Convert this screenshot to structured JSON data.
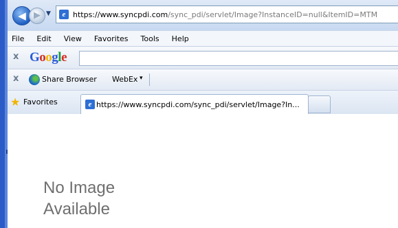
{
  "browser": {
    "url_scheme": "https://",
    "url_domain": "www.syncpdi.com",
    "url_path": "/sync_pdi/servlet/Image?InstanceID=null&ItemID=MTM",
    "menu": [
      "File",
      "Edit",
      "View",
      "Favorites",
      "Tools",
      "Help"
    ],
    "google_toolbar": {
      "logo_letters": [
        "G",
        "o",
        "o",
        "g",
        "l",
        "e"
      ],
      "close_label": "x",
      "search_value": ""
    },
    "share_toolbar": {
      "close_label": "x",
      "share_label": "Share Browser",
      "webex_label": "WebEx",
      "dropdown_glyph": "▾"
    },
    "favorites_bar": {
      "favorites_label": "Favorites",
      "tab_title": "https://www.syncpdi.com/sync_pdi/servlet/Image?In..."
    }
  },
  "content": {
    "line1": "No Image",
    "line2": "Available"
  },
  "colors": {
    "accent": "#2b5bc7",
    "placeholder_text": "#6f6f6f"
  }
}
